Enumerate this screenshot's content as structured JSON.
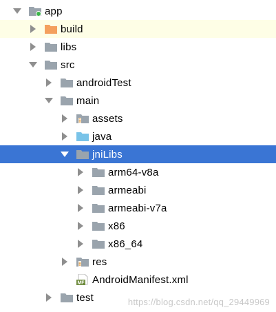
{
  "colors": {
    "selected_bg": "#3a75d4",
    "highlight_bg": "#fefee6",
    "folder_gray": "#9aa4ad",
    "folder_orange": "#f4a05e",
    "folder_blue": "#79c3e8",
    "module_dot": "#3bb54a",
    "arrow_gray": "#8f8f8f"
  },
  "tree": [
    {
      "label": "app",
      "depth": 0,
      "expanded": true,
      "icon": "module-folder-icon"
    },
    {
      "label": "build",
      "depth": 1,
      "expanded": false,
      "icon": "excluded-folder-icon",
      "highlight": true
    },
    {
      "label": "libs",
      "depth": 1,
      "expanded": false,
      "icon": "folder-icon"
    },
    {
      "label": "src",
      "depth": 1,
      "expanded": true,
      "icon": "folder-icon"
    },
    {
      "label": "androidTest",
      "depth": 2,
      "expanded": false,
      "icon": "folder-icon"
    },
    {
      "label": "main",
      "depth": 2,
      "expanded": true,
      "icon": "folder-icon"
    },
    {
      "label": "assets",
      "depth": 3,
      "expanded": false,
      "icon": "resource-folder-icon"
    },
    {
      "label": "java",
      "depth": 3,
      "expanded": false,
      "icon": "source-folder-icon"
    },
    {
      "label": "jniLibs",
      "depth": 3,
      "expanded": true,
      "icon": "folder-icon",
      "selected": true
    },
    {
      "label": "arm64-v8a",
      "depth": 4,
      "expanded": false,
      "icon": "folder-icon"
    },
    {
      "label": "armeabi",
      "depth": 4,
      "expanded": false,
      "icon": "folder-icon"
    },
    {
      "label": "armeabi-v7a",
      "depth": 4,
      "expanded": false,
      "icon": "folder-icon"
    },
    {
      "label": "x86",
      "depth": 4,
      "expanded": false,
      "icon": "folder-icon"
    },
    {
      "label": "x86_64",
      "depth": 4,
      "expanded": false,
      "icon": "folder-icon"
    },
    {
      "label": "res",
      "depth": 3,
      "expanded": false,
      "icon": "resource-folder-icon"
    },
    {
      "label": "AndroidManifest.xml",
      "depth": 3,
      "leaf": true,
      "icon": "manifest-file-icon",
      "icon_text": "MF"
    },
    {
      "label": "test",
      "depth": 2,
      "expanded": false,
      "icon": "folder-icon"
    }
  ],
  "watermark": "https://blog.csdn.net/qq_29449969"
}
